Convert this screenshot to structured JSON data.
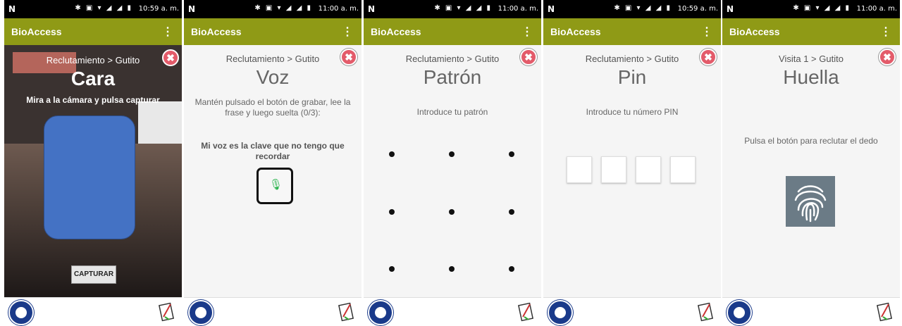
{
  "status": {
    "network_icon": "N",
    "icons": "bluetooth nfc wifi signal signal battery",
    "times": [
      "10:59 a. m.",
      "11:00 a. m.",
      "11:00 a. m.",
      "10:59 a. m.",
      "11:00 a. m."
    ]
  },
  "app": {
    "title": "BioAccess",
    "menu_icon": "⋮"
  },
  "close_symbol": "✖",
  "screens": {
    "cara": {
      "breadcrumb": "Reclutamiento > Gutito",
      "title": "Cara",
      "instruction": "Mira a la cámara y pulsa capturar",
      "capture_label": "CAPTURAR"
    },
    "voz": {
      "breadcrumb": "Reclutamiento > Gutito",
      "title": "Voz",
      "instruction": "Mantén pulsado el botón de grabar, lee la frase y luego suelta (0/3):",
      "phrase": "Mi voz es la clave que no tengo que recordar"
    },
    "patron": {
      "breadcrumb": "Reclutamiento > Gutito",
      "title": "Patrón",
      "instruction": "Introduce tu patrón"
    },
    "pin": {
      "breadcrumb": "Reclutamiento > Gutito",
      "title": "Pin",
      "instruction": "Introduce tu número PIN"
    },
    "huella": {
      "breadcrumb": "Visita 1 > Gutito",
      "title": "Huella",
      "instruction": "Pulsa el botón para reclutar el dedo"
    }
  },
  "colors": {
    "appbar": "#8f9a16",
    "close": "#e35b6a",
    "mic": "#26b34a",
    "face_blur": "#4472c4",
    "fingerprint_bg": "#6b7b86"
  }
}
